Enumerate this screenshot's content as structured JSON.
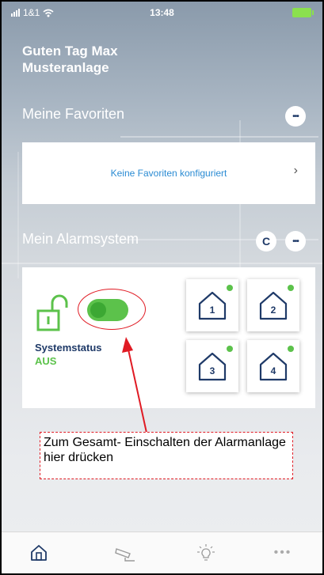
{
  "status_bar": {
    "carrier": "1&1",
    "time": "13:48"
  },
  "greeting": {
    "line1": "Guten Tag Max",
    "line2": "Musteranlage"
  },
  "favorites": {
    "title": "Meine Favoriten",
    "empty_text": "Keine Favoriten konfiguriert",
    "more_label": "•••",
    "chevron": "›"
  },
  "alarm": {
    "title": "Mein Alarmsystem",
    "more_label": "•••",
    "refresh_label": "C",
    "status_label": "Systemstatus",
    "status_value": "AUS",
    "zones": [
      {
        "label": "1"
      },
      {
        "label": "2"
      },
      {
        "label": "3"
      },
      {
        "label": "4"
      }
    ]
  },
  "annotation": {
    "text": "Zum Gesamt- Einschalten der Alarmanlage hier drücken"
  },
  "tabbar": {
    "more_label": "•••"
  },
  "colors": {
    "accent_green": "#5cc24b",
    "navy": "#1f3a68",
    "link_blue": "#2a8bd3",
    "annotation_red": "#e01b24"
  },
  "icons": [
    "wifi-icon",
    "battery-icon",
    "more-icon",
    "refresh-icon",
    "chevron-right-icon",
    "unlocked-padlock-icon",
    "house-zone-icon",
    "home-tab-icon",
    "camera-tab-icon",
    "lightbulb-tab-icon",
    "more-tab-icon"
  ]
}
